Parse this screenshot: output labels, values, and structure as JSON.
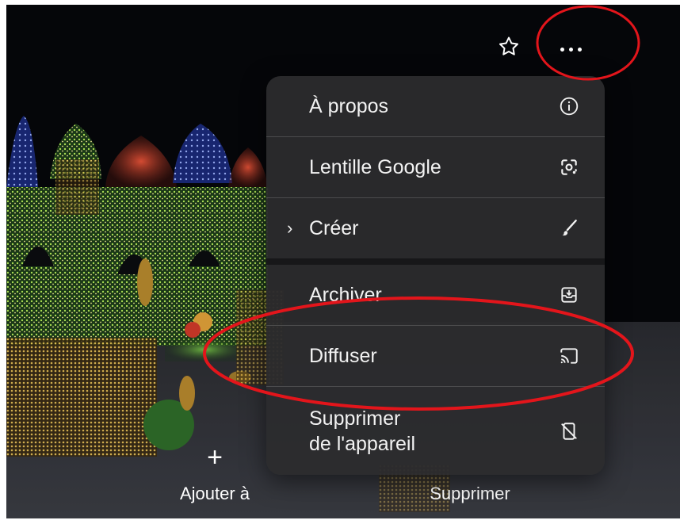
{
  "toolbar": {
    "favorite_icon": "star-outline-icon",
    "more_icon": "more-horizontal-icon"
  },
  "menu": {
    "items": [
      {
        "label": "À propos",
        "icon": "info-icon"
      },
      {
        "label": "Lentille Google",
        "icon": "google-lens-icon"
      },
      {
        "label": "Créer",
        "icon": "brush-icon",
        "chevron": "›"
      },
      {
        "label": "Archiver",
        "icon": "archive-icon"
      },
      {
        "label": "Diffuser",
        "icon": "cast-icon"
      },
      {
        "label": "Supprimer\nde l'appareil",
        "icon": "delete-from-device-icon"
      }
    ]
  },
  "bottom_bar": {
    "add_label": "Ajouter à",
    "add_icon": "plus-icon",
    "delete_label": "Supprimer"
  },
  "colors": {
    "menu_bg": "#2c2c2e",
    "annotation": "#e3151b",
    "text": "#f2f2f2"
  }
}
